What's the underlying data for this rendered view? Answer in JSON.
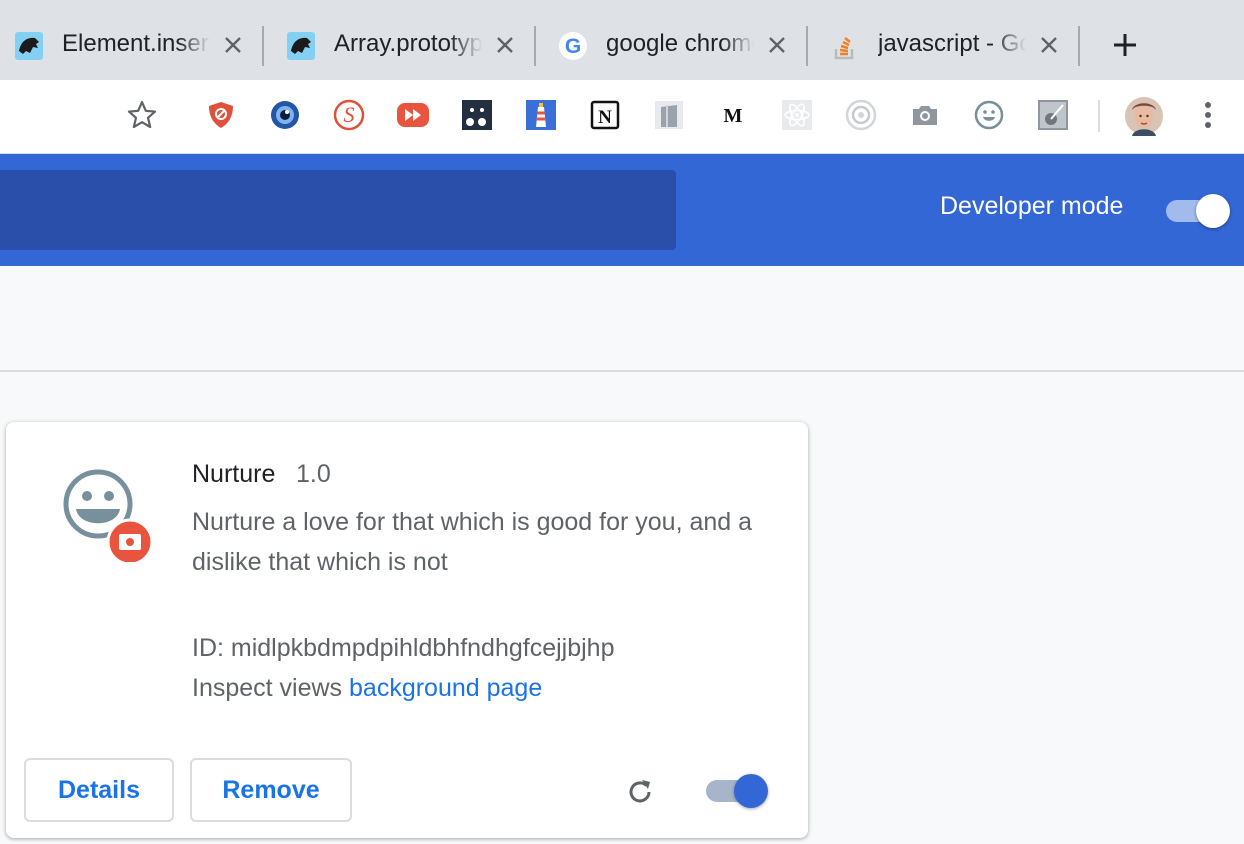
{
  "tabs": [
    {
      "title": "Element.insertAdjacentHTML",
      "favicon": "mdn-dino-icon",
      "close_icon": "close-icon"
    },
    {
      "title": "Array.prototype",
      "favicon": "mdn-dino-icon",
      "close_icon": "close-icon"
    },
    {
      "title": "google chrome",
      "favicon": "google-g-icon",
      "close_icon": "close-icon"
    },
    {
      "title": "javascript - Google",
      "favicon": "stackoverflow-icon",
      "close_icon": "close-icon"
    }
  ],
  "toolbar": {
    "bookmark_icon": "star-icon",
    "extensions": [
      "ublock-shield-icon",
      "eye-blue-icon",
      "script-s-icon",
      "fast-forward-icon",
      "dots-dark-icon",
      "lighthouse-icon",
      "notion-icon",
      "box-gray-icon",
      "medium-m-icon",
      "react-atom-icon",
      "eye-ring-icon",
      "camera-icon",
      "smiley-icon",
      "square-gray-icon"
    ],
    "medium_letter": "M",
    "notion_letter": "N",
    "avatar": "profile-avatar",
    "menu_icon": "kebab-menu-icon"
  },
  "header": {
    "developer_mode_label": "Developer mode",
    "developer_mode_on": true
  },
  "extension": {
    "name": "Nurture",
    "version": "1.0",
    "description": "Nurture a love for that which is good for you, and a dislike that which is not",
    "id_text": "ID: midlpkbdmpdpihldbhfndhgfcejjbjhp",
    "inspect_label": "Inspect views",
    "inspect_link": "background page",
    "details_label": "Details",
    "remove_label": "Remove",
    "enabled": true,
    "icon": "smiley-face-icon"
  },
  "colors": {
    "accent": "#3367d6",
    "link": "#1a73e8",
    "header_search": "#2a4fab"
  }
}
